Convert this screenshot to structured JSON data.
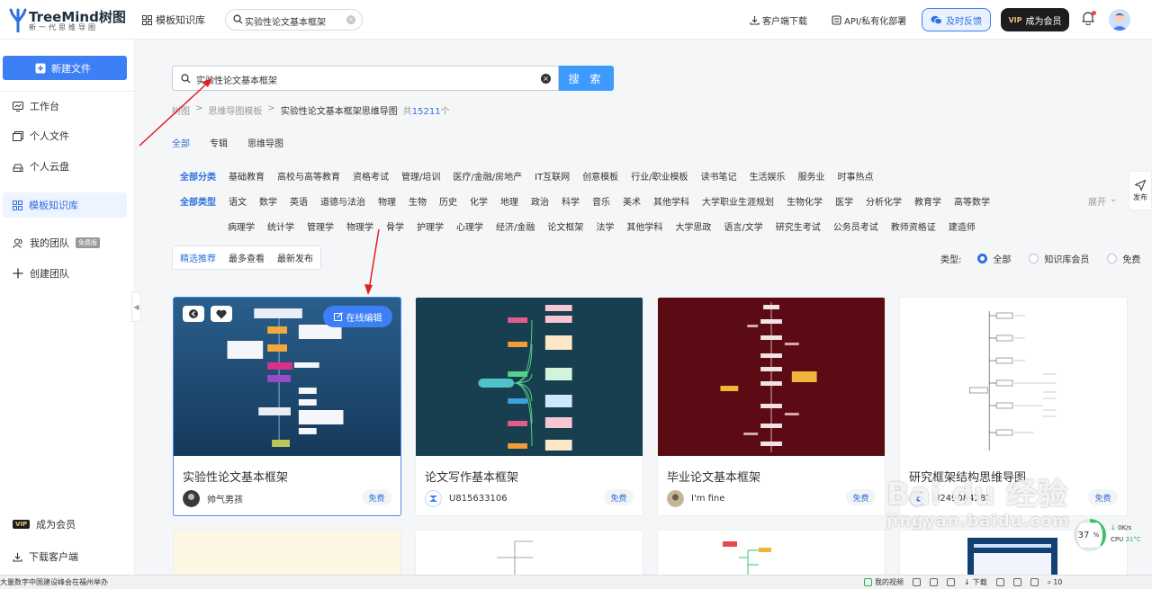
{
  "brand": {
    "name": "TreeMind树图",
    "slogan": "新一代思维导图"
  },
  "header": {
    "template_link": "模板知识库",
    "search_value": "实验性论文基本框架",
    "client_download": "客户端下载",
    "api_deploy": "API/私有化部署",
    "feedback": "及时反馈",
    "vip_tag": "VIP",
    "vip_cta": "成为会员"
  },
  "sidebar": {
    "new_file": "新建文件",
    "items": [
      {
        "label": "工作台"
      },
      {
        "label": "个人文件"
      },
      {
        "label": "个人云盘"
      },
      {
        "label": "模板知识库"
      },
      {
        "label": "我的团队"
      },
      {
        "label": "创建团队"
      }
    ],
    "team_badge": "免费版",
    "vip_tag": "VIP",
    "become_vip": "成为会员",
    "download_client": "下载客户端"
  },
  "search": {
    "value": "实验性论文基本框架",
    "button": "搜 索"
  },
  "breadcrumb": {
    "root": "树图",
    "sep": ">",
    "level1": "思维导图模板",
    "current": "实验性论文基本框架思维导图",
    "count_prefix": "共",
    "count": "15211",
    "count_suffix": "个"
  },
  "tabs": [
    "全部",
    "专辑",
    "思维导图"
  ],
  "categories": [
    "全部分类",
    "基础教育",
    "高校与高等教育",
    "资格考试",
    "管理/培训",
    "医疗/金融/房地产",
    "IT互联网",
    "创意模板",
    "行业/职业模板",
    "读书笔记",
    "生活娱乐",
    "服务业",
    "时事热点"
  ],
  "types_row1": [
    "全部类型",
    "语文",
    "数学",
    "英语",
    "道德与法治",
    "物理",
    "生物",
    "历史",
    "化学",
    "地理",
    "政治",
    "科学",
    "音乐",
    "美术",
    "其他学科",
    "大学职业生涯规划",
    "生物化学",
    "医学",
    "分析化学",
    "教育学",
    "高等数学"
  ],
  "types_row2": [
    "病理学",
    "统计学",
    "管理学",
    "物理学",
    "骨学",
    "护理学",
    "心理学",
    "经济/金融",
    "论文框架",
    "法学",
    "其他学科",
    "大学思政",
    "语言/文学",
    "研究生考试",
    "公务员考试",
    "教师资格证",
    "建造师"
  ],
  "expand_label": "展开",
  "sort_tabs": [
    "精选推荐",
    "最多查看",
    "最新发布"
  ],
  "type_filter": {
    "label": "类型:",
    "options": [
      "全部",
      "知识库会员",
      "免费"
    ]
  },
  "cards": [
    {
      "title": "实验性论文基本框架",
      "author": "帅气男孩",
      "price": "免费",
      "thumb_bg": "#1f4f7a",
      "online_edit": "在线编辑",
      "thumb_title": "实验性论文基本框架"
    },
    {
      "title": "论文写作基本框架",
      "author": "U815633106",
      "price": "免费",
      "thumb_bg": "#173f4f"
    },
    {
      "title": "毕业论文基本框架",
      "author": "I'm fine",
      "price": "免费",
      "thumb_bg": "#5c0b14"
    },
    {
      "title": "研究框架结构思维导图",
      "author": "U249084282",
      "price": "免费",
      "thumb_bg": "#ffffff"
    }
  ],
  "right_float": "发布",
  "status_bar": {
    "left_text": "大量数字中国建设峰会在福州举办",
    "video": "我的视频",
    "download": "下载",
    "zoom": "10"
  },
  "system_monitor": {
    "percent": "37",
    "percent_unit": "%",
    "net": "0K/s",
    "cpu_label": "CPU",
    "cpu_temp": "31°C"
  },
  "watermark": {
    "main": "Bai du 经验",
    "sub": "jingyan.baidu.com"
  },
  "colors": {
    "accent": "#3d7ff5",
    "search_button": "#3d9bff",
    "vip_dark": "#1d1d1f",
    "vip_gold": "#e7c37a"
  }
}
